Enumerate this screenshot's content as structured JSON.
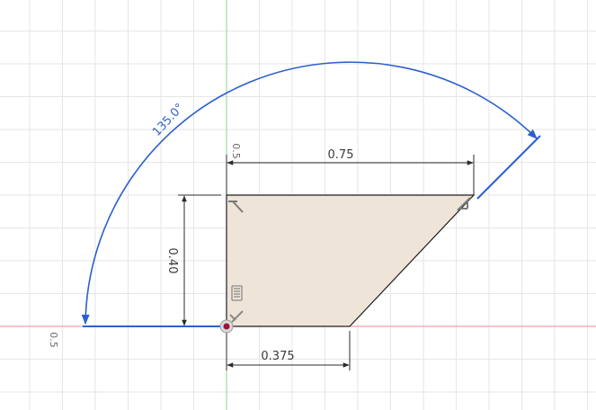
{
  "colors": {
    "background": "#ffffff",
    "grid": "#e6e6e6",
    "x_axis": "#e88f8f",
    "y_axis": "#8fd38f",
    "profile_fill": "#efe4d8",
    "profile_stroke": "#1e1e1e",
    "dimension": "#2b2b2b",
    "angle_dim": "#2d5fd0",
    "origin": "#a0103a"
  },
  "dimensions": {
    "top_width": "0.75",
    "height": "0.40",
    "bottom_width": "0.375",
    "angle": "135.0°"
  },
  "grid_labels": {
    "top": "0.5",
    "left": "0.5"
  },
  "icons": {
    "horizontal_constraint": "T-constraint-icon",
    "vertical_constraint": "parallel-constraint-icon",
    "fix_constraint": "lock-constraint-icon",
    "origin": "origin-point-icon"
  }
}
